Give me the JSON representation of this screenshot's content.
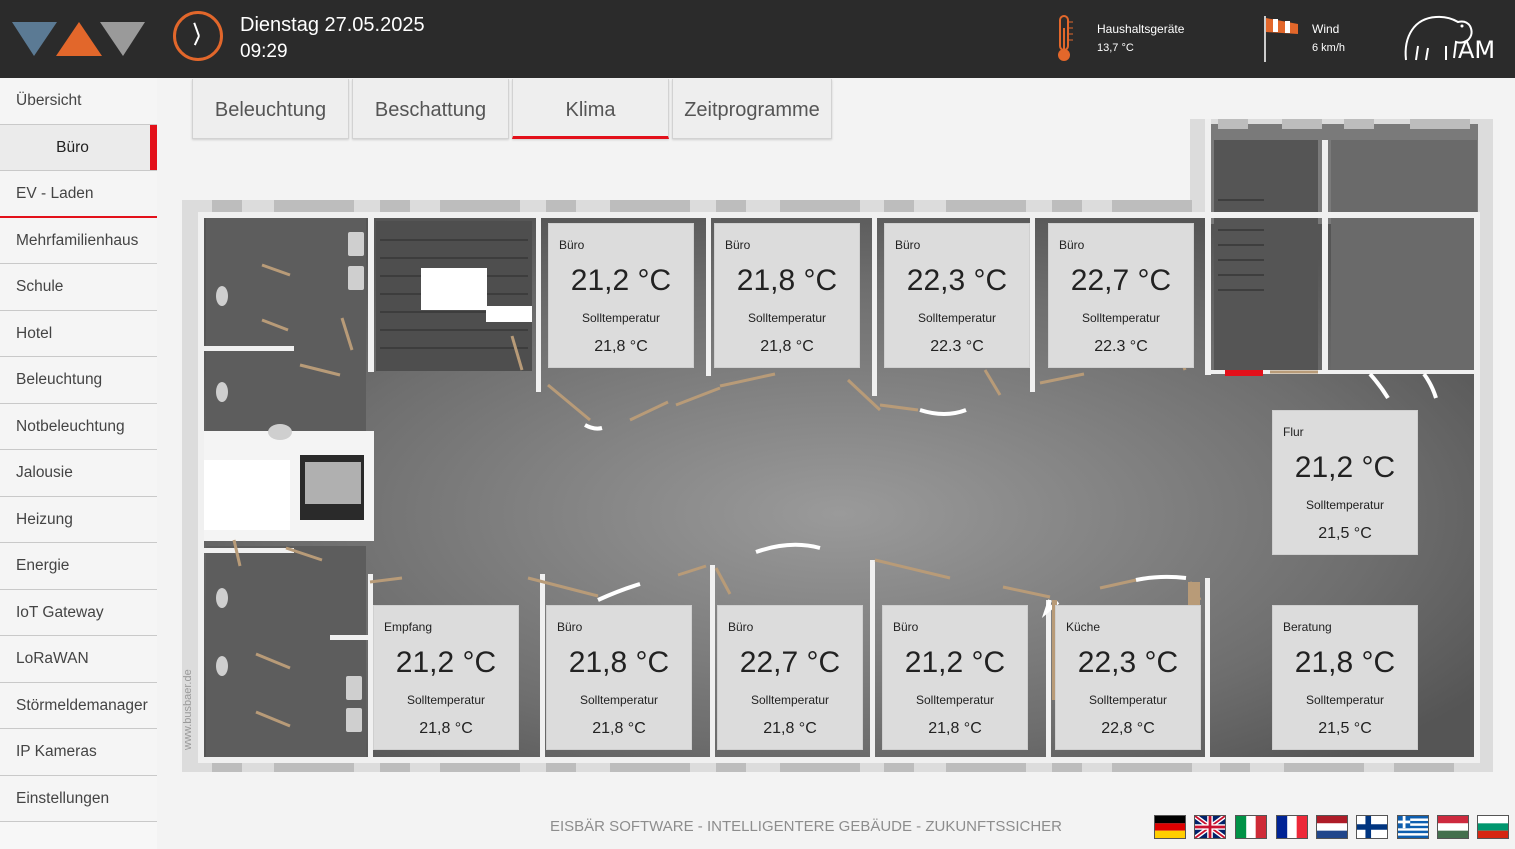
{
  "header": {
    "date": "Dienstag 27.05.2025",
    "time": "09:29",
    "household_label": "Haushaltsgeräte",
    "household_value": "13,7 °C",
    "wind_label": "Wind",
    "wind_value": "6 km/h"
  },
  "sidebar": {
    "items": [
      {
        "label": "Übersicht"
      },
      {
        "label": "Büro"
      },
      {
        "label": "EV - Laden"
      },
      {
        "label": "Mehrfamilienhaus"
      },
      {
        "label": "Schule"
      },
      {
        "label": "Hotel"
      },
      {
        "label": "Beleuchtung"
      },
      {
        "label": "Notbeleuchtung"
      },
      {
        "label": "Jalousie"
      },
      {
        "label": "Heizung"
      },
      {
        "label": "Energie"
      },
      {
        "label": "IoT Gateway"
      },
      {
        "label": "LoRaWAN"
      },
      {
        "label": "Störmeldemanager"
      },
      {
        "label": "IP Kameras"
      },
      {
        "label": "Einstellungen"
      }
    ]
  },
  "tabs": [
    {
      "label": "Beleuchtung"
    },
    {
      "label": "Beschattung"
    },
    {
      "label": "Klima"
    },
    {
      "label": "Zeitprogramme"
    }
  ],
  "rooms": [
    {
      "name": "Büro",
      "temp": "21,2 °C",
      "soll_label": "Solltemperatur",
      "setpoint": "21,8 °C"
    },
    {
      "name": "Büro",
      "temp": "21,8 °C",
      "soll_label": "Solltemperatur",
      "setpoint": "21,8 °C"
    },
    {
      "name": "Büro",
      "temp": "22,3 °C",
      "soll_label": "Solltemperatur",
      "setpoint": "22.3 °C"
    },
    {
      "name": "Büro",
      "temp": "22,7 °C",
      "soll_label": "Solltemperatur",
      "setpoint": "22.3 °C"
    },
    {
      "name": "Flur",
      "temp": "21,2 °C",
      "soll_label": "Solltemperatur",
      "setpoint": "21,5 °C"
    },
    {
      "name": "Empfang",
      "temp": "21,2 °C",
      "soll_label": "Solltemperatur",
      "setpoint": "21,8 °C"
    },
    {
      "name": "Büro",
      "temp": "21,8 °C",
      "soll_label": "Solltemperatur",
      "setpoint": "21,8 °C"
    },
    {
      "name": "Büro",
      "temp": "22,7 °C",
      "soll_label": "Solltemperatur",
      "setpoint": "21,8 °C"
    },
    {
      "name": "Büro",
      "temp": "21,2 °C",
      "soll_label": "Solltemperatur",
      "setpoint": "21,8 °C"
    },
    {
      "name": "Küche",
      "temp": "22,3 °C",
      "soll_label": "Solltemperatur",
      "setpoint": "22,8 °C"
    },
    {
      "name": "Beratung",
      "temp": "21,8 °C",
      "soll_label": "Solltemperatur",
      "setpoint": "21,5 °C"
    }
  ],
  "watermark": "www.busbaer.de",
  "footer": {
    "tagline": "EISBÄR SOFTWARE - INTELLIGENTERE GEBÄUDE - ZUKUNFTSSICHER"
  },
  "languages": [
    {
      "name": "german-flag-icon"
    },
    {
      "name": "english-flag-icon"
    },
    {
      "name": "italian-flag-icon"
    },
    {
      "name": "french-flag-icon"
    },
    {
      "name": "dutch-flag-icon"
    },
    {
      "name": "finnish-flag-icon"
    },
    {
      "name": "greek-flag-icon"
    },
    {
      "name": "hungarian-flag-icon"
    },
    {
      "name": "bulgarian-flag-icon"
    }
  ],
  "colors": {
    "accent_red": "#e3101a",
    "logo_blue": "#5b7a94",
    "logo_orange": "#e2672b",
    "logo_gray": "#9a9a9a",
    "header_bg": "#2b2b2b"
  }
}
